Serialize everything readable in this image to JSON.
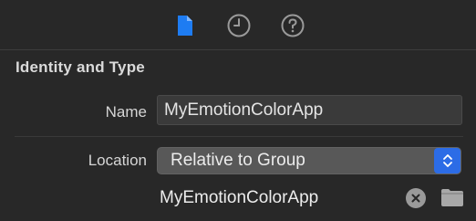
{
  "inspector": {
    "tabs": [
      {
        "icon": "file-icon",
        "selected": true,
        "color": "#1e7cf2"
      },
      {
        "icon": "history-clock-icon",
        "selected": false,
        "color": "#9a9a9a"
      },
      {
        "icon": "help-question-icon",
        "selected": false,
        "color": "#9a9a9a"
      }
    ]
  },
  "identity": {
    "section_title": "Identity and Type",
    "name_label": "Name",
    "name_value": "MyEmotionColorApp",
    "location_label": "Location",
    "location_value": "Relative to Group",
    "path_value": "MyEmotionColorApp"
  },
  "colors": {
    "background": "#282828",
    "accent": "#2c6ce6",
    "selected_tab": "#1e7cf2"
  }
}
